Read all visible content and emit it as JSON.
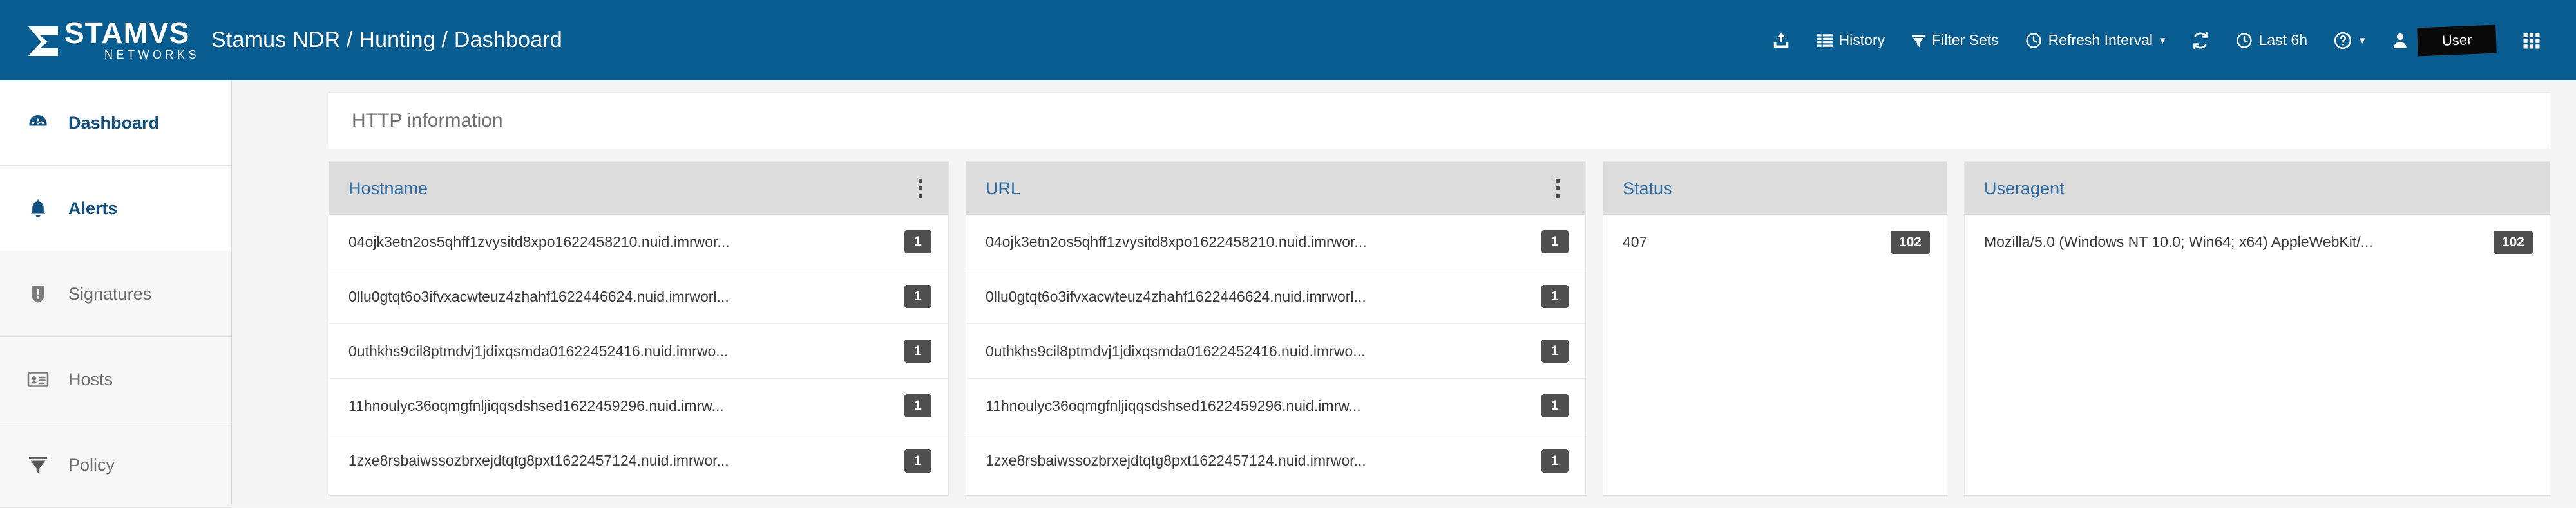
{
  "topbar": {
    "logo_word": "STAMVS",
    "logo_sub": "NETWORKS",
    "title": "Stamus NDR / Hunting / Dashboard",
    "items": [
      {
        "icon": "upload-icon",
        "label": ""
      },
      {
        "icon": "history-icon",
        "label": "History"
      },
      {
        "icon": "filter-icon",
        "label": "Filter Sets"
      },
      {
        "icon": "clock-icon",
        "label": "Refresh Interval",
        "caret": "⌄"
      },
      {
        "icon": "refresh-icon",
        "label": ""
      },
      {
        "icon": "clock-icon",
        "label": "Last 6h"
      },
      {
        "icon": "help-icon",
        "label": "",
        "caret": "⌄"
      },
      {
        "icon": "user-icon",
        "label": ""
      }
    ],
    "user_label": "User",
    "grid_icon": "grid-icon",
    "accent": "#095c8f"
  },
  "sidebar": {
    "items": [
      {
        "label": "Dashboard",
        "icon": "gauge-icon",
        "active": true
      },
      {
        "label": "Alerts",
        "icon": "bell-icon",
        "active": true
      },
      {
        "label": "Signatures",
        "icon": "shield-icon",
        "active": false
      },
      {
        "label": "Hosts",
        "icon": "id-card-icon",
        "active": false
      },
      {
        "label": "Policy",
        "icon": "funnel-icon",
        "active": false
      }
    ]
  },
  "main": {
    "panel_title": "HTTP information",
    "columns": [
      {
        "header": "Hostname",
        "has_menu": true,
        "rows": [
          {
            "value": "04ojk3etn2os5qhff1zvysitd8xpo1622458210.nuid.imrwor...",
            "count": "1"
          },
          {
            "value": "0llu0gtqt6o3ifvxacwteuz4zhahf1622446624.nuid.imrworl...",
            "count": "1"
          },
          {
            "value": "0uthkhs9cil8ptmdvj1jdixqsmda01622452416.nuid.imrwo...",
            "count": "1"
          },
          {
            "value": "11hnoulyc36oqmgfnljiqqsdshsed1622459296.nuid.imrw...",
            "count": "1"
          },
          {
            "value": "1zxe8rsbaiwssozbrxejdtqtg8pxt1622457124.nuid.imrwor...",
            "count": "1"
          }
        ]
      },
      {
        "header": "URL",
        "has_menu": true,
        "rows": [
          {
            "value": "04ojk3etn2os5qhff1zvysitd8xpo1622458210.nuid.imrwor...",
            "count": "1"
          },
          {
            "value": "0llu0gtqt6o3ifvxacwteuz4zhahf1622446624.nuid.imrworl...",
            "count": "1"
          },
          {
            "value": "0uthkhs9cil8ptmdvj1jdixqsmda01622452416.nuid.imrwo...",
            "count": "1"
          },
          {
            "value": "11hnoulyc36oqmgfnljiqqsdshsed1622459296.nuid.imrw...",
            "count": "1"
          },
          {
            "value": "1zxe8rsbaiwssozbrxejdtqtg8pxt1622457124.nuid.imrwor...",
            "count": "1"
          }
        ]
      },
      {
        "header": "Status",
        "has_menu": false,
        "rows": [
          {
            "value": "407",
            "count": "102"
          }
        ]
      },
      {
        "header": "Useragent",
        "has_menu": false,
        "rows": [
          {
            "value": "Mozilla/5.0 (Windows NT 10.0; Win64; x64) AppleWebKit/...",
            "count": "102"
          }
        ]
      }
    ]
  }
}
